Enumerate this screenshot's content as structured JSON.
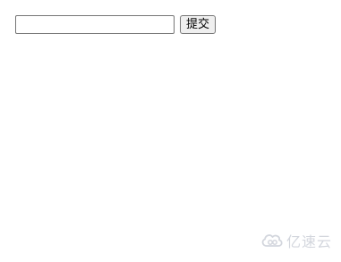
{
  "form": {
    "input_value": "",
    "input_placeholder": "",
    "submit_label": "提交"
  },
  "watermark": {
    "brand_text": "亿速云",
    "logo_icon": "cloud-logo-icon",
    "color": "#b0b6c3"
  }
}
